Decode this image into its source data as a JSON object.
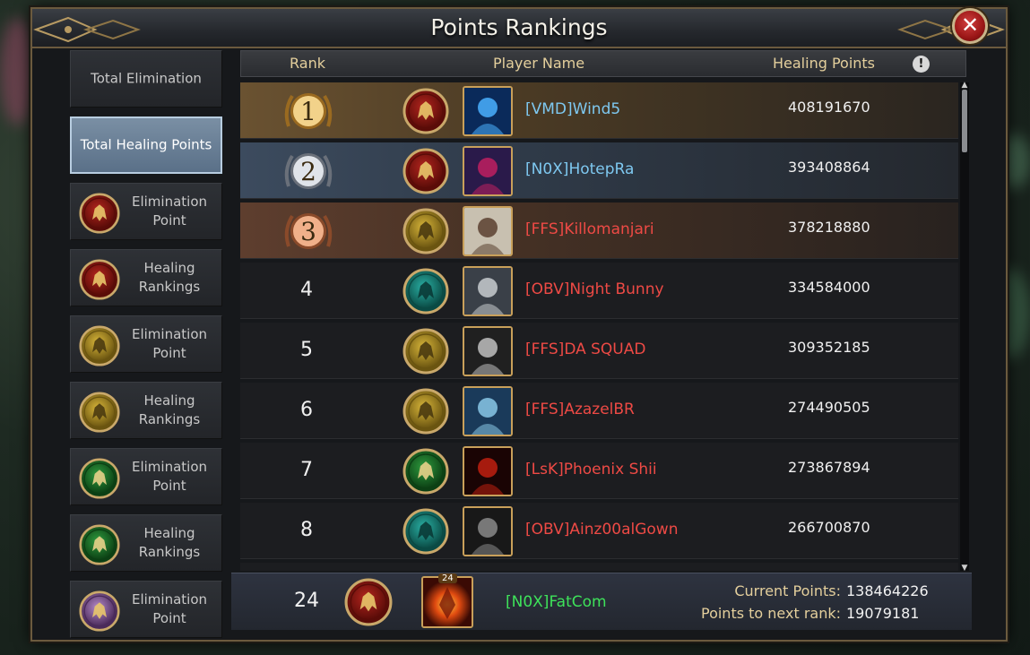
{
  "window": {
    "title": "Points Rankings",
    "close_label": "✕"
  },
  "colors": {
    "name_blue": "#7ec8f0",
    "name_red": "#ee4a45",
    "name_green": "#3ee25a",
    "header_gold": "#e4cf9c"
  },
  "sidebar": [
    {
      "label": "Total Elimination",
      "icon": "",
      "active": false
    },
    {
      "label": "Total Healing Points",
      "icon": "",
      "active": true
    },
    {
      "label": "Elimination Point",
      "icon": "lion-red-crest-icon",
      "active": false
    },
    {
      "label": "Healing Rankings",
      "icon": "lion-red-crest-icon",
      "active": false
    },
    {
      "label": "Elimination Point",
      "icon": "wolf-gold-crest-icon",
      "active": false
    },
    {
      "label": "Healing Rankings",
      "icon": "wolf-gold-crest-icon",
      "active": false
    },
    {
      "label": "Elimination Point",
      "icon": "flower-green-crest-icon",
      "active": false
    },
    {
      "label": "Healing Rankings",
      "icon": "flower-green-crest-icon",
      "active": false
    },
    {
      "label": "Elimination Point",
      "icon": "dragon-purple-crest-icon",
      "active": false
    }
  ],
  "table": {
    "headers": {
      "rank": "Rank",
      "player": "Player Name",
      "points": "Healing Points"
    },
    "info_icon": "!",
    "rows": [
      {
        "rank": "1",
        "faction": "lion-red-crest-icon",
        "avatar": "blue-dragon-eye-avatar",
        "name": "[VMD]Wind5",
        "name_color": "blue",
        "points": "408191670"
      },
      {
        "rank": "2",
        "faction": "lion-red-crest-icon",
        "avatar": "hooded-figure-avatar",
        "name": "[N0X]HotepRa",
        "name_color": "blue",
        "points": "393408864"
      },
      {
        "rank": "3",
        "faction": "wolf-gold-crest-icon",
        "avatar": "bearded-man-cap-avatar",
        "name": "[FFS]Killomanjari",
        "name_color": "red",
        "points": "378218880"
      },
      {
        "rank": "4",
        "faction": "kraken-teal-crest-icon",
        "avatar": "dark-knight-avatar",
        "name": "[OBV]Night Bunny",
        "name_color": "red",
        "points": "334584000"
      },
      {
        "rank": "5",
        "faction": "wolf-gold-crest-icon",
        "avatar": "da-squad-logo-avatar",
        "name": "[FFS]DA SQUAD",
        "name_color": "red",
        "points": "309352185"
      },
      {
        "rank": "6",
        "faction": "wolf-gold-crest-icon",
        "avatar": "ice-warrior-avatar",
        "name": "[FFS]AzazelBR",
        "name_color": "red",
        "points": "274490505"
      },
      {
        "rank": "7",
        "faction": "flower-green-crest-icon",
        "avatar": "red-hooded-avatar",
        "name": "[LsK]Phoenix Shii",
        "name_color": "red",
        "points": "273867894"
      },
      {
        "rank": "8",
        "faction": "kraken-teal-crest-icon",
        "avatar": "skull-helmet-avatar",
        "name": "[OBV]Ainz00alGown",
        "name_color": "red",
        "points": "266700870"
      }
    ]
  },
  "my_entry": {
    "rank": "24",
    "faction": "lion-red-crest-icon",
    "avatar": "fire-phoenix-avatar",
    "avatar_badge": "24",
    "name": "[N0X]FatCom",
    "current_label": "Current Points:",
    "current_value": "138464226",
    "next_label": "Points to next rank:",
    "next_value": "19079181"
  }
}
